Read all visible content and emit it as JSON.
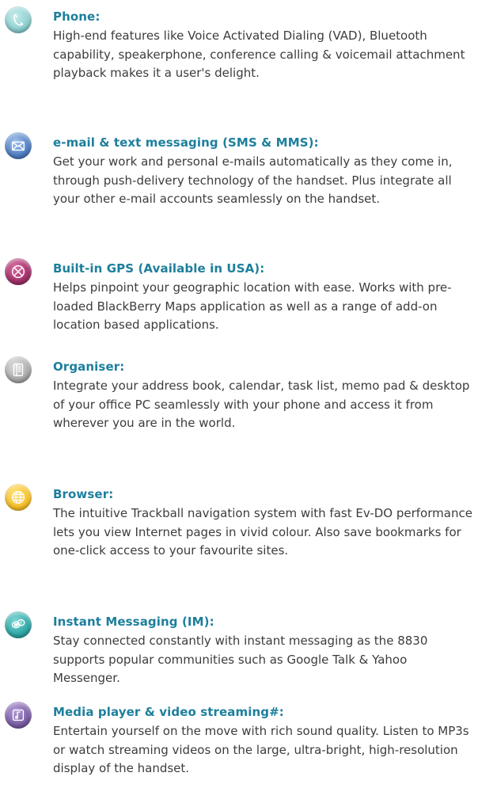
{
  "colors": {
    "title": "#1d7f9c",
    "body": "#3c3c3c",
    "phone_icon": "#8ecfd0",
    "email_icon": "#4f7fc2",
    "gps_icon": "#a2316b",
    "organiser_icon": "#a9a9a9",
    "browser_icon": "#f6c028",
    "im_icon": "#2ea7a5",
    "media_icon": "#7a5ea5"
  },
  "features": [
    {
      "icon": "phone-icon",
      "title": "Phone:",
      "text": "High-end features like Voice Activated Dialing (VAD), Bluetooth capability, speakerphone, conference calling & voicemail attachment playback makes it a user's delight."
    },
    {
      "icon": "envelope-icon",
      "title": "e-mail & text messaging (SMS & MMS):",
      "text": "Get your work and personal e-mails automatically as they come in, through push-delivery technology of the handset. Plus integrate all your other e-mail accounts seamlessly on the handset."
    },
    {
      "icon": "gps-icon",
      "title": "Built-in GPS (Available in USA):",
      "text": "Helps pinpoint your geographic location with ease. Works with pre-loaded BlackBerry Maps application as well as a range of add-on location based applications."
    },
    {
      "icon": "organiser-icon",
      "title": "Organiser:",
      "text": "Integrate your address book, calendar, task list, memo pad & desktop of your office PC seamlessly with your phone and access it from wherever you are in the world."
    },
    {
      "icon": "globe-icon",
      "title": "Browser:",
      "text": "The intuitive Trackball navigation system with fast Ev-DO performance lets you view Internet pages in vivid colour. Also save bookmarks for one-click access to your favourite sites."
    },
    {
      "icon": "chat-bubbles-icon",
      "title": "Instant Messaging (IM):",
      "text": "Stay connected constantly with instant messaging as the 8830 supports popular communities such as Google Talk & Yahoo Messenger."
    },
    {
      "icon": "music-note-icon",
      "title": "Media player & video streaming#:",
      "text": "Entertain yourself on the move with rich sound quality. Listen to MP3s or watch streaming videos on the large, ultra-bright, high-resolution display of the handset."
    }
  ]
}
